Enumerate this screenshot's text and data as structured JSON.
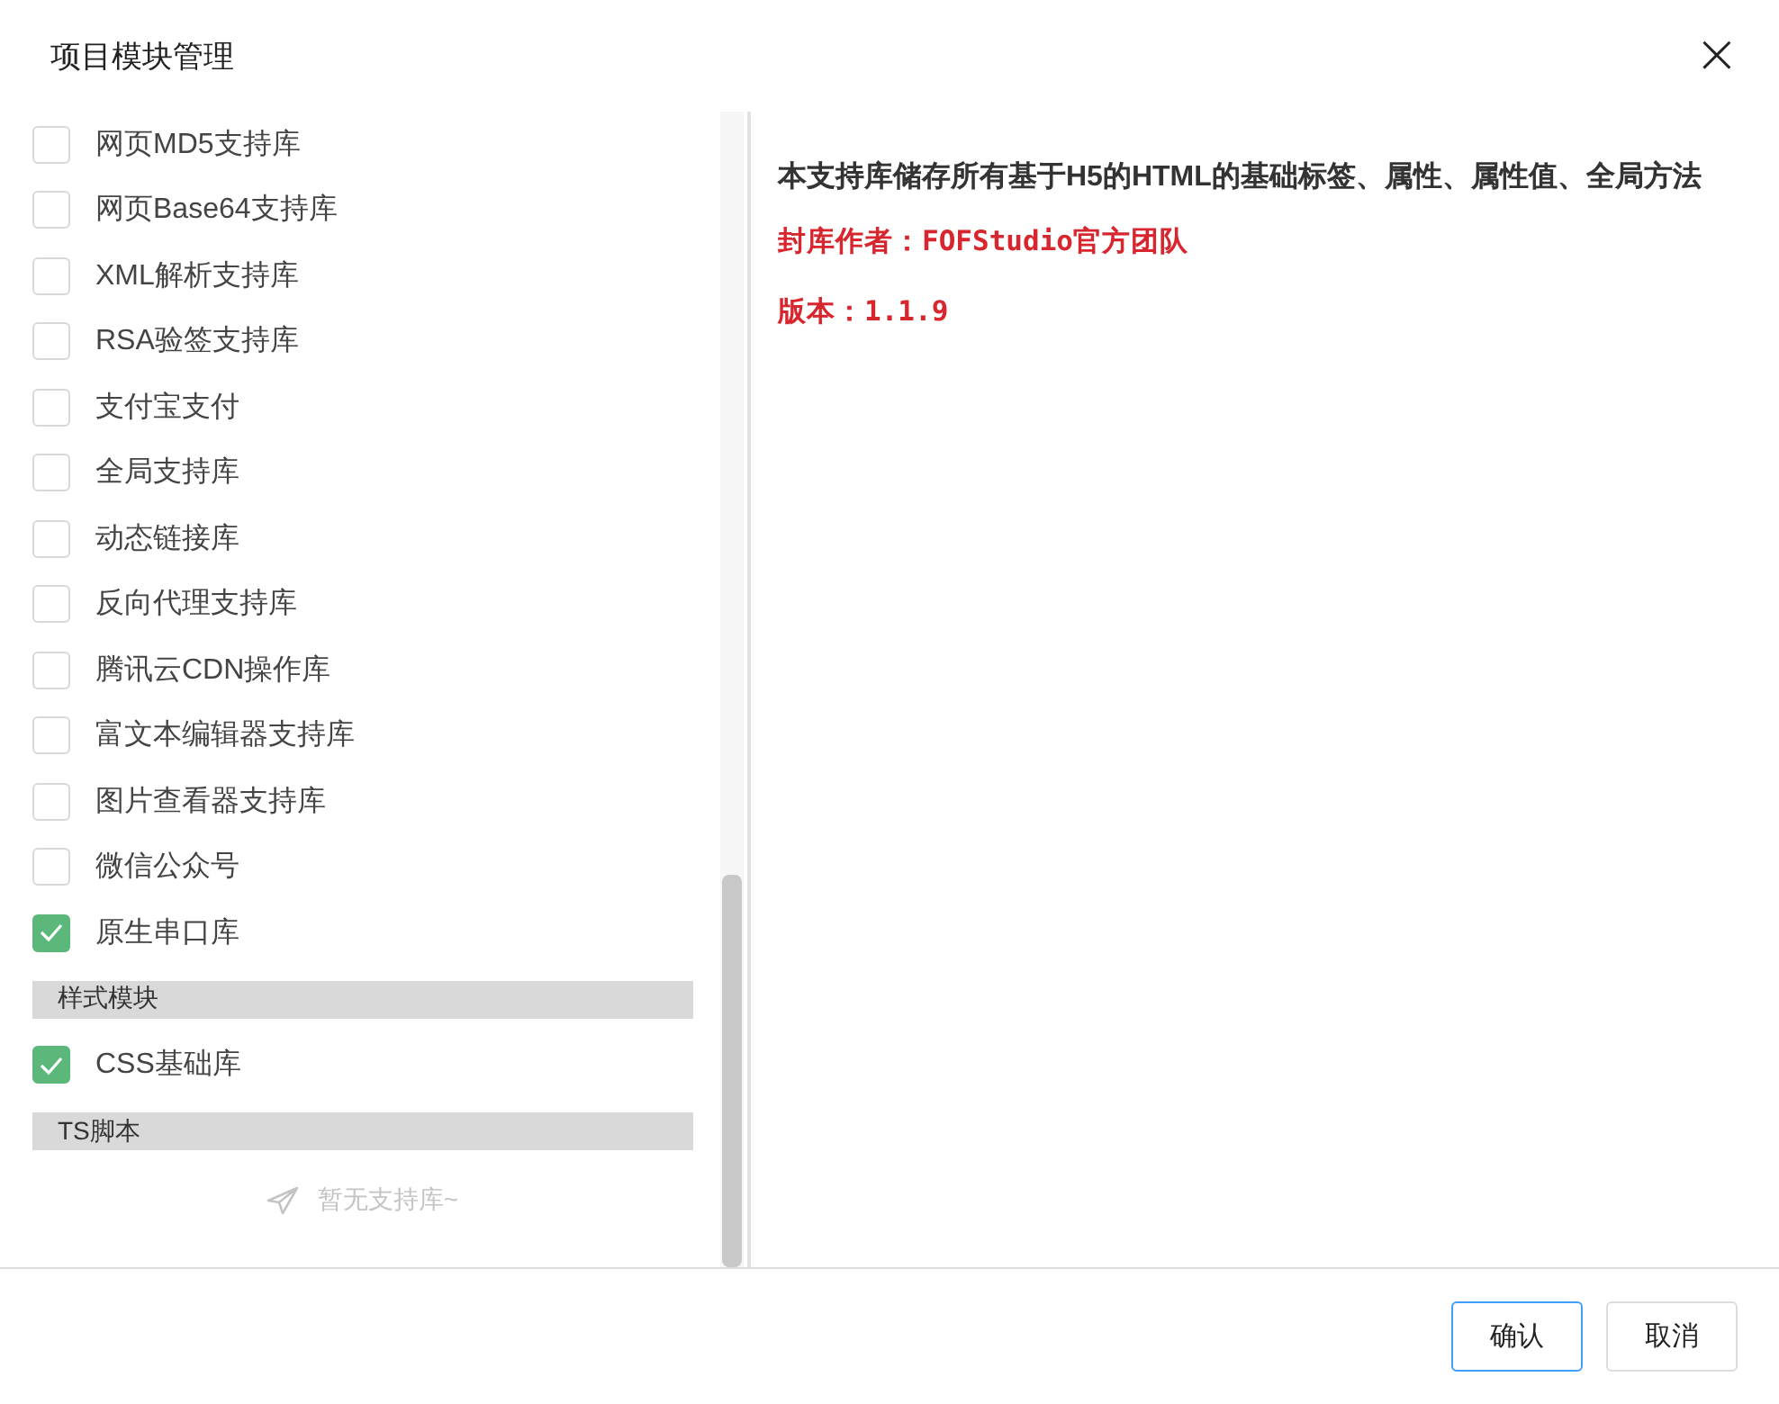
{
  "dialog": {
    "title": "项目模块管理",
    "close": "×"
  },
  "modules": [
    {
      "kind": "option",
      "label": "网页MD5支持库",
      "checked": false
    },
    {
      "kind": "option",
      "label": "网页Base64支持库",
      "checked": false
    },
    {
      "kind": "option",
      "label": "XML解析支持库",
      "checked": false
    },
    {
      "kind": "option",
      "label": "RSA验签支持库",
      "checked": false
    },
    {
      "kind": "option",
      "label": "支付宝支付",
      "checked": false
    },
    {
      "kind": "option",
      "label": "全局支持库",
      "checked": false
    },
    {
      "kind": "option",
      "label": "动态链接库",
      "checked": false
    },
    {
      "kind": "option",
      "label": "反向代理支持库",
      "checked": false
    },
    {
      "kind": "option",
      "label": "腾讯云CDN操作库",
      "checked": false
    },
    {
      "kind": "option",
      "label": "富文本编辑器支持库",
      "checked": false
    },
    {
      "kind": "option",
      "label": "图片查看器支持库",
      "checked": false
    },
    {
      "kind": "option",
      "label": "微信公众号",
      "checked": false
    },
    {
      "kind": "option",
      "label": "原生串口库",
      "checked": true
    },
    {
      "kind": "section",
      "label": "样式模块"
    },
    {
      "kind": "option",
      "label": "CSS基础库",
      "checked": true
    },
    {
      "kind": "section",
      "label": "TS脚本"
    },
    {
      "kind": "empty",
      "label": "暂无支持库~"
    }
  ],
  "details": {
    "description": "本支持库储存所有基于H5的HTML的基础标签、属性、属性值、全局方法",
    "author": "封库作者：FOFStudio官方团队",
    "version": "版本：1.1.9"
  },
  "buttons": [
    "确认",
    "取消"
  ]
}
